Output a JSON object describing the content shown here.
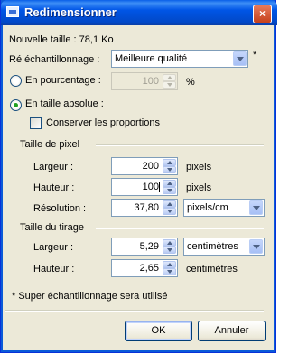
{
  "window": {
    "title": "Redimensionner",
    "close_label": "×"
  },
  "new_size": "Nouvelle taille : 78,1 Ko",
  "resampling": {
    "label": "Ré échantillonnage :",
    "value": "Meilleure qualité",
    "note_mark": "*"
  },
  "percentage": {
    "label": "En pourcentage :",
    "value": "100",
    "unit": "%"
  },
  "absolute": {
    "label": "En taille absolue :",
    "keep_ratio_label": "Conserver les proportions"
  },
  "pixel_size": {
    "section": "Taille de pixel",
    "width_label": "Largeur :",
    "width_value": "200",
    "width_unit": "pixels",
    "height_label": "Hauteur :",
    "height_value": "100",
    "height_unit": "pixels",
    "resolution_label": "Résolution :",
    "resolution_value": "37,80",
    "resolution_unit": "pixels/cm"
  },
  "print_size": {
    "section": "Taille du tirage",
    "width_label": "Largeur :",
    "width_value": "5,29",
    "width_unit": "centimètres",
    "height_label": "Hauteur :",
    "height_value": "2,65",
    "height_unit": "centimètres"
  },
  "footnote": "* Super échantillonnage sera utilisé",
  "buttons": {
    "ok": "OK",
    "cancel": "Annuler"
  },
  "colors": {
    "titlebar": "#0055e6",
    "dialog_bg": "#ece9d8",
    "radio_dot": "#21a121"
  }
}
